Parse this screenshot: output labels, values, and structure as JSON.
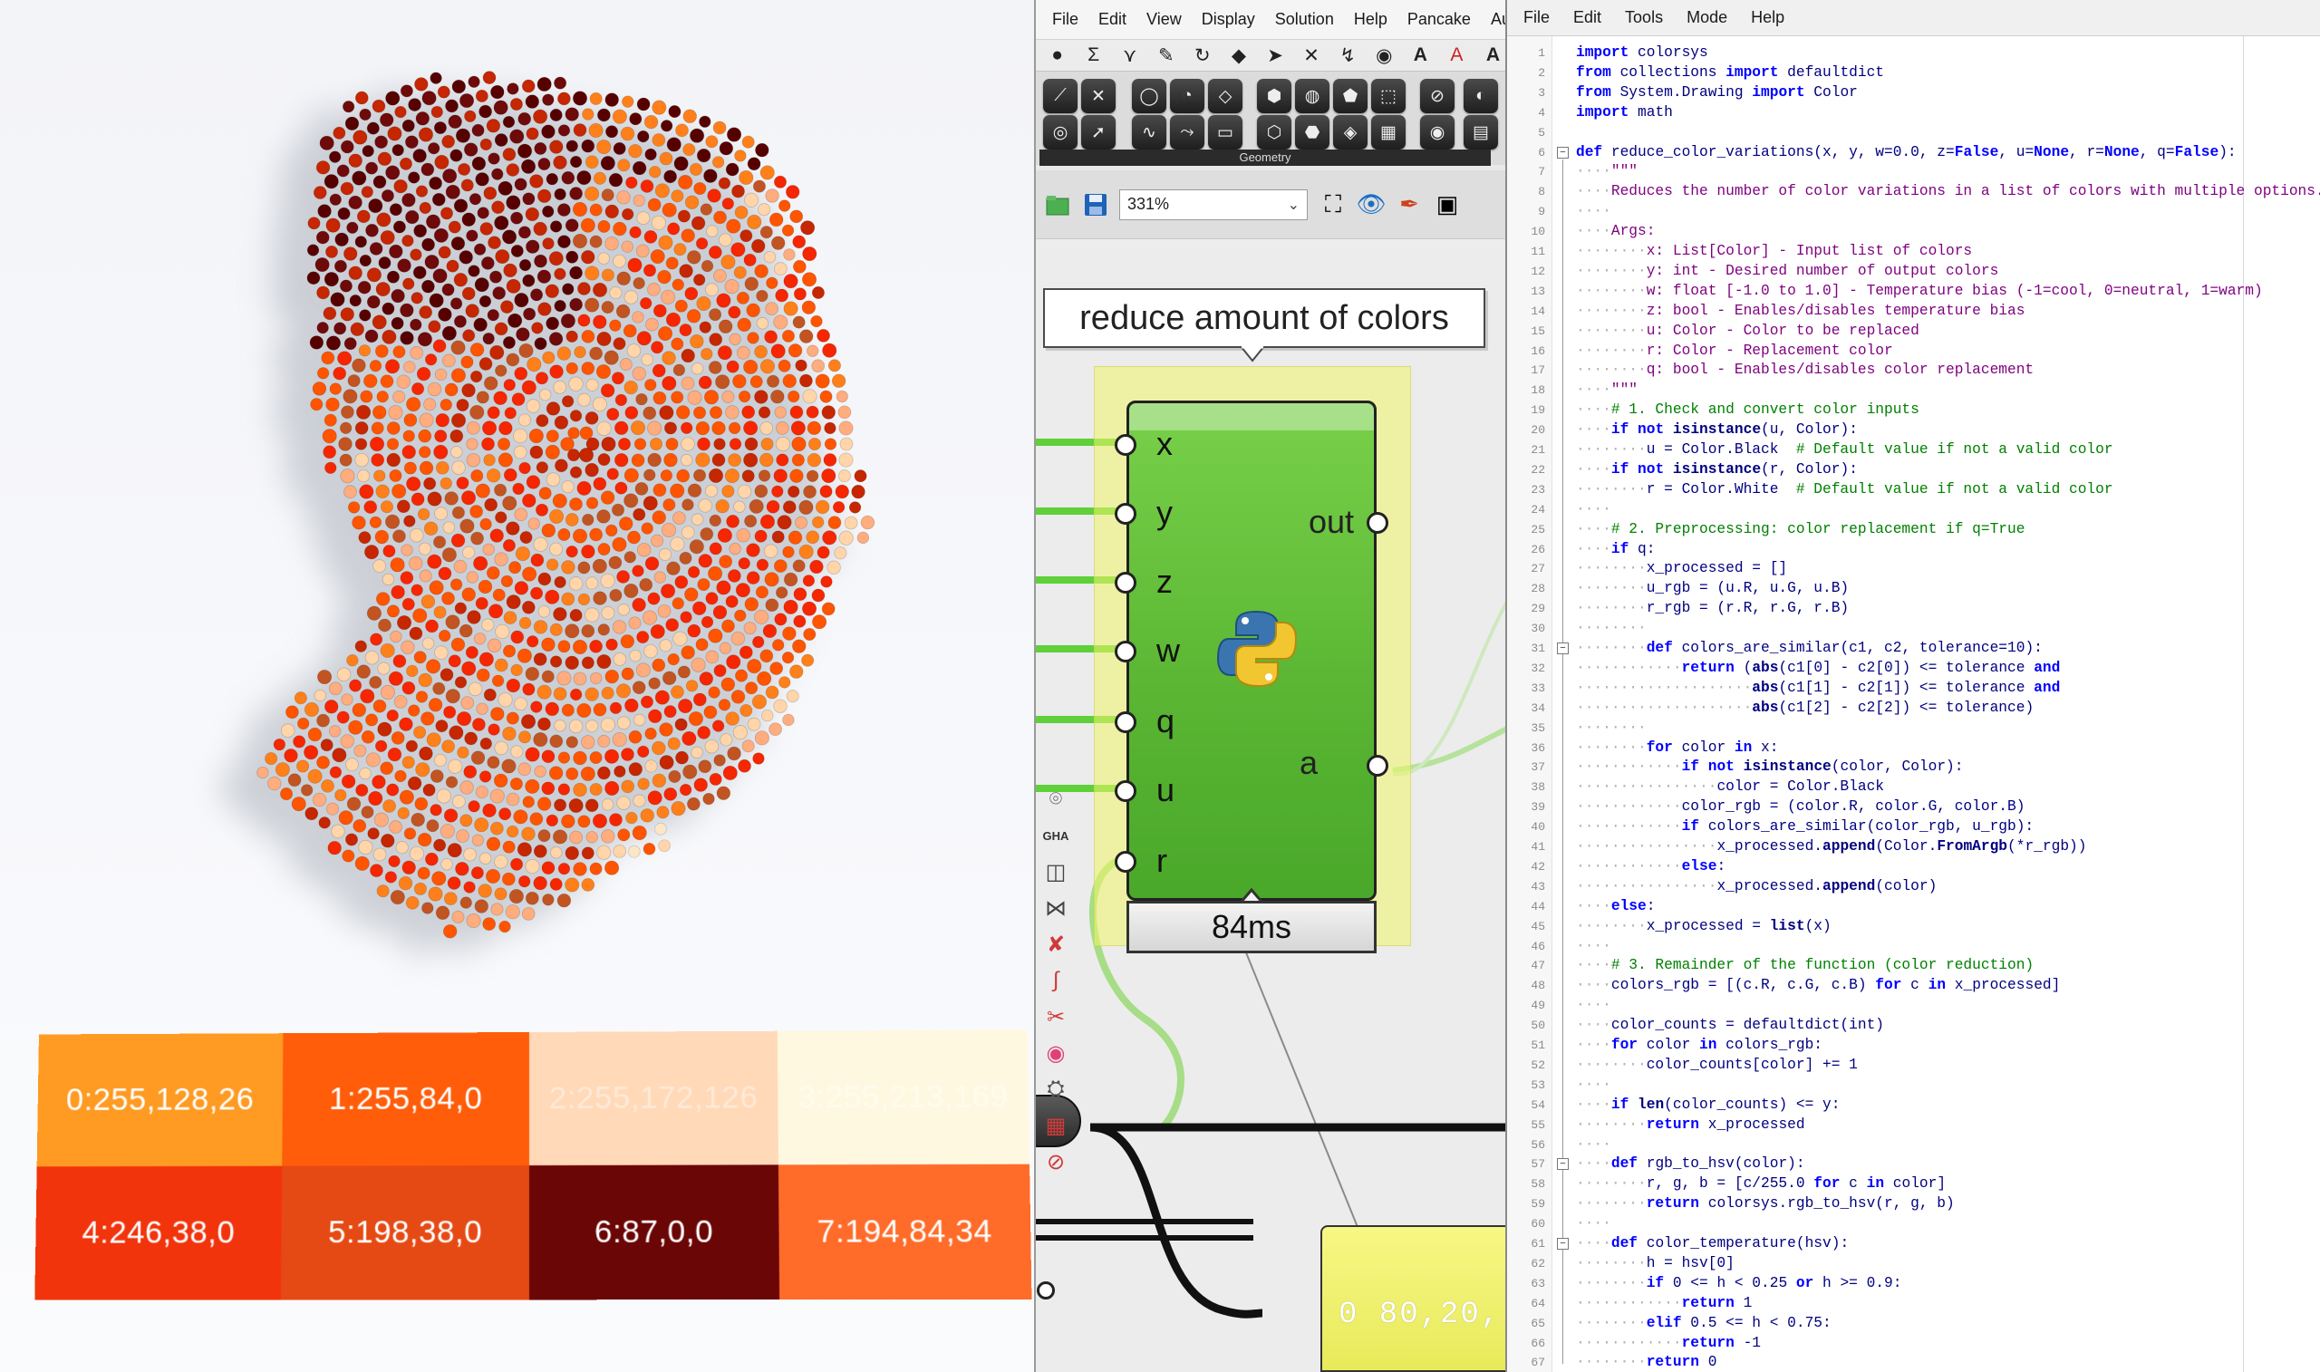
{
  "render": {
    "dot_palette": [
      "#ff801a",
      "#ff5400",
      "#ffac7e",
      "#ffd5a9",
      "#f62600",
      "#c62600",
      "#570000",
      "#c25422",
      "#fbe6c8"
    ],
    "swatches": [
      {
        "label": "0:255,128,26",
        "color": "#ff9a22"
      },
      {
        "label": "1:255,84,0",
        "color": "#ff5d0a"
      },
      {
        "label": "2:255,172,126",
        "color": "#ffd9b8"
      },
      {
        "label": "3:255,213,169",
        "color": "#fff8e0"
      },
      {
        "label": "4:246,38,0",
        "color": "#f2340c"
      },
      {
        "label": "5:198,38,0",
        "color": "#e64a14"
      },
      {
        "label": "6:87,0,0",
        "color": "#6b0606"
      },
      {
        "label": "7:194,84,34",
        "color": "#ff6c2a"
      }
    ]
  },
  "grasshopper": {
    "menu": [
      "File",
      "Edit",
      "View",
      "Display",
      "Solution",
      "Help",
      "Pancake",
      "Au"
    ],
    "tab_glyphs": [
      "●",
      "Σ",
      "⋎",
      "✎",
      "↻",
      "◆",
      "➤",
      "✕",
      "↯",
      "◉",
      "A",
      "A",
      "A"
    ],
    "ribbon_caption": "Geometry",
    "zoom": "331%",
    "callout": "reduce amount of colors",
    "component": {
      "inputs": [
        "x",
        "y",
        "z",
        "w",
        "q",
        "u",
        "r"
      ],
      "outputs": [
        "out",
        "a"
      ]
    },
    "timing": "84ms",
    "panel_text": "0 80,20,"
  },
  "editor": {
    "menu": [
      "File",
      "Edit",
      "Tools",
      "Mode",
      "Help"
    ],
    "lines": [
      "import colorsys",
      "from collections import defaultdict",
      "from System.Drawing import Color",
      "import math",
      "",
      "def reduce_color_variations(x, y, w=0.0, z=False, u=None, r=None, q=False):",
      "····\"\"\"",
      "····Reduces the number of color variations in a list of colors with multiple options.",
      "····",
      "····Args:",
      "········x: List[Color] - Input list of colors",
      "········y: int - Desired number of output colors",
      "········w: float [-1.0 to 1.0] - Temperature bias (-1=cool, 0=neutral, 1=warm)",
      "········z: bool - Enables/disables temperature bias",
      "········u: Color - Color to be replaced",
      "········r: Color - Replacement color",
      "········q: bool - Enables/disables color replacement",
      "····\"\"\"",
      "····# 1. Check and convert color inputs",
      "····if not isinstance(u, Color):",
      "········u = Color.Black  # Default value if not a valid color",
      "····if not isinstance(r, Color):",
      "········r = Color.White  # Default value if not a valid color",
      "····",
      "····# 2. Preprocessing: color replacement if q=True",
      "····if q:",
      "········x_processed = []",
      "········u_rgb = (u.R, u.G, u.B)",
      "········r_rgb = (r.R, r.G, r.B)",
      "········",
      "········def colors_are_similar(c1, c2, tolerance=10):",
      "············return (abs(c1[0] - c2[0]) <= tolerance and",
      "····················abs(c1[1] - c2[1]) <= tolerance and",
      "····················abs(c1[2] - c2[2]) <= tolerance)",
      "········",
      "········for color in x:",
      "············if not isinstance(color, Color):",
      "················color = Color.Black",
      "············color_rgb = (color.R, color.G, color.B)",
      "············if colors_are_similar(color_rgb, u_rgb):",
      "················x_processed.append(Color.FromArgb(*r_rgb))",
      "············else:",
      "················x_processed.append(color)",
      "····else:",
      "········x_processed = list(x)",
      "····",
      "····# 3. Remainder of the function (color reduction)",
      "····colors_rgb = [(c.R, c.G, c.B) for c in x_processed]",
      "····",
      "····color_counts = defaultdict(int)",
      "····for color in colors_rgb:",
      "········color_counts[color] += 1",
      "····",
      "····if len(color_counts) <= y:",
      "········return x_processed",
      "····",
      "····def rgb_to_hsv(color):",
      "········r, g, b = [c/255.0 for c in color]",
      "········return colorsys.rgb_to_hsv(r, g, b)",
      "····",
      "····def color_temperature(hsv):",
      "········h = hsv[0]",
      "········if 0 <= h < 0.25 or h >= 0.9:",
      "············return 1",
      "········elif 0.5 <= h < 0.75:",
      "············return -1",
      "········return 0"
    ]
  }
}
